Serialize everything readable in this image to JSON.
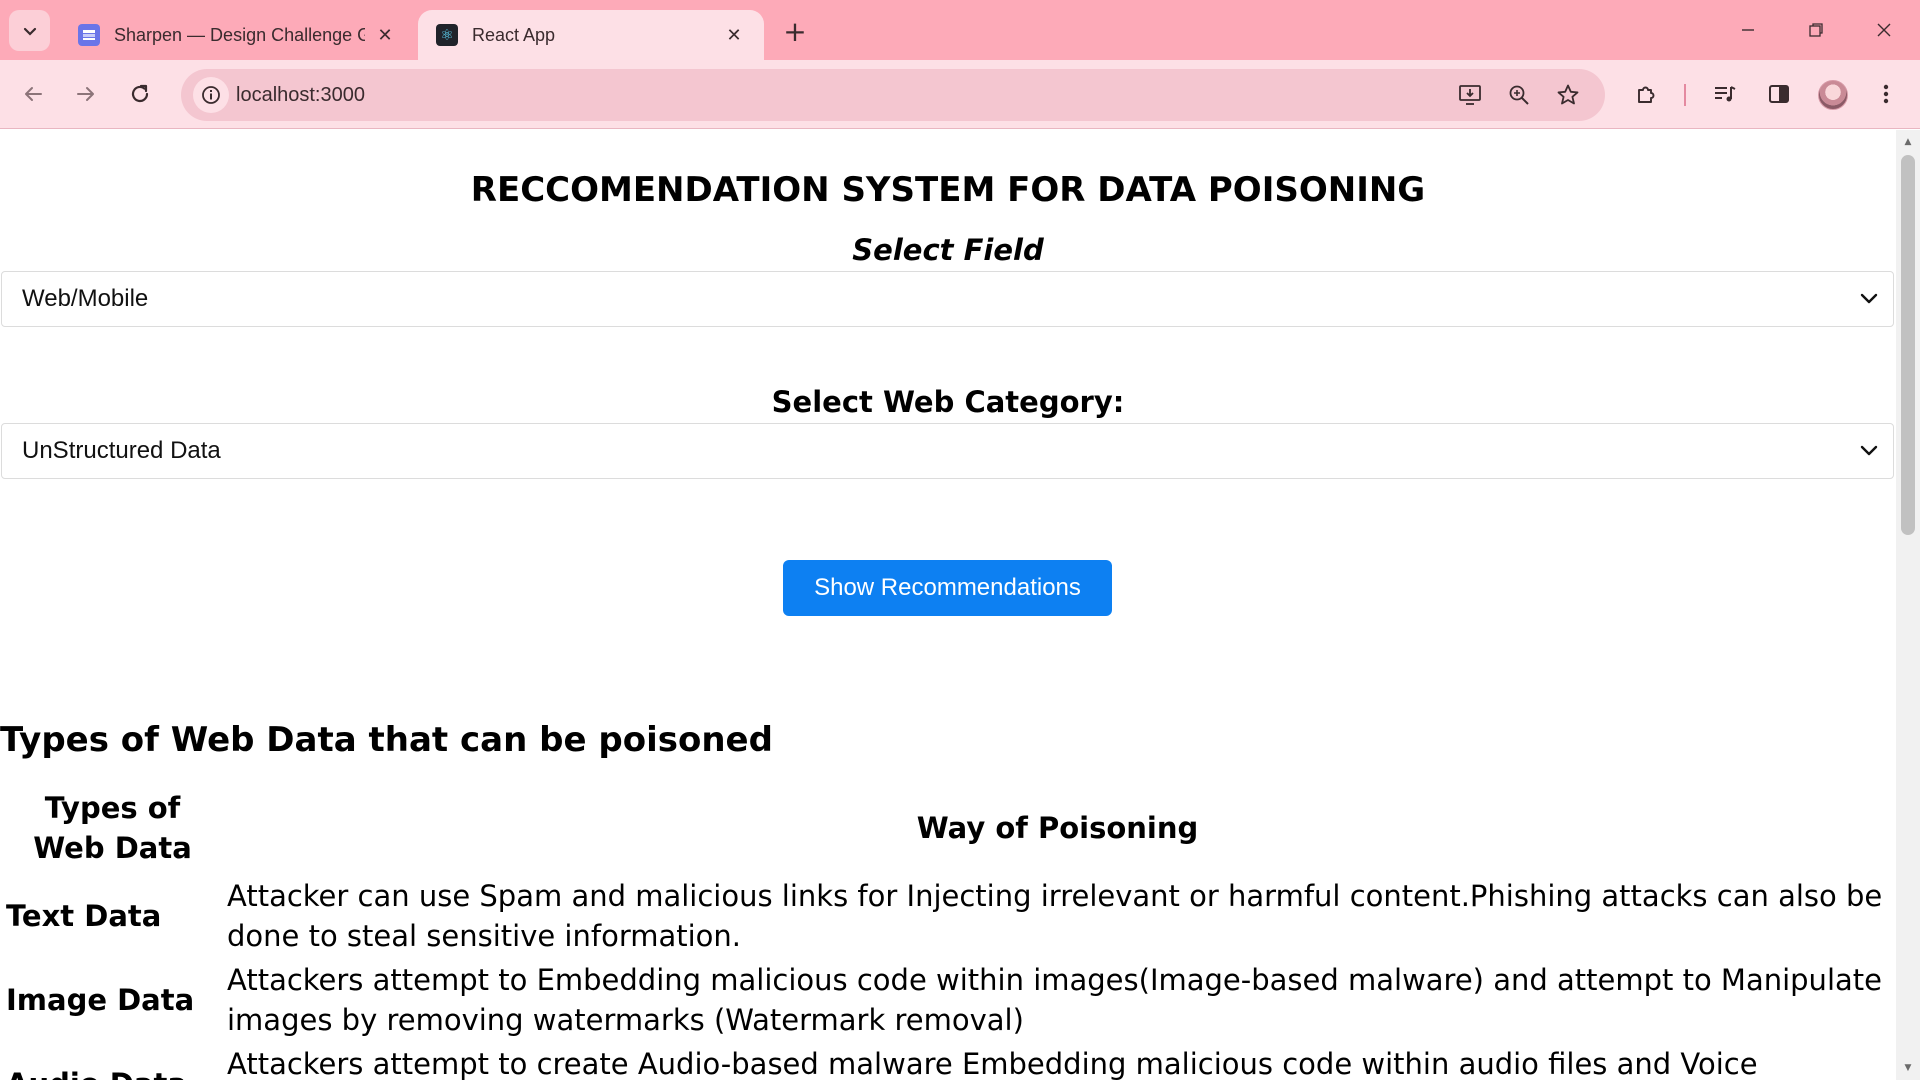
{
  "browser": {
    "tabs": [
      {
        "title": "Sharpen — Design Challenge G",
        "active": false
      },
      {
        "title": "React App",
        "active": true
      }
    ],
    "url": "localhost:3000"
  },
  "page": {
    "title": "RECCOMENDATION SYSTEM FOR DATA POISONING",
    "field_label": "Select Field",
    "field_value": "Web/Mobile",
    "category_label": "Select Web Category:",
    "category_value": "UnStructured Data",
    "button_label": "Show Recommendations",
    "section_heading": "Types of Web Data that can be poisoned",
    "table": {
      "headers": [
        "Types of Web Data",
        "Way of Poisoning"
      ],
      "rows": [
        {
          "type": "Text Data",
          "way": "Attacker can use Spam and malicious links for Injecting irrelevant or harmful content.Phishing attacks can also be done to steal sensitive information."
        },
        {
          "type": "Image Data",
          "way": "Attackers attempt to Embedding malicious code within images(Image-based malware) and attempt to Manipulate images by removing watermarks (Watermark removal)"
        },
        {
          "type": "Audio Data",
          "way": "Attackers attempt to create Audio-based malware Embedding malicious code within audio files and Voice phishing by Using"
        }
      ]
    }
  },
  "colors": {
    "tabstrip": "#fdaab8",
    "toolbar": "#fde0e6",
    "button": "#0d80f2"
  }
}
